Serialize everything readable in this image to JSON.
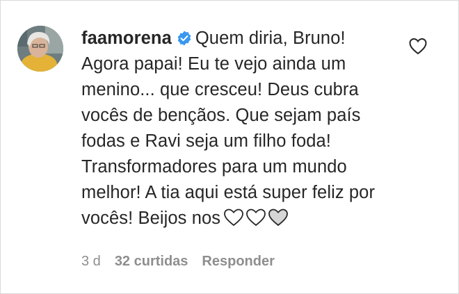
{
  "comment": {
    "username": "faamorena",
    "text": "Quem diria, Bruno! Agora papai! Eu te vejo ainda um menino... que cresceu! Deus cubra vocês de bençãos. Que sejam país fodas e Ravi seja um filho foda! Transformadores para um mundo melhor! A tia aqui está super feliz por vocês! Beijos nos",
    "emojis": [
      "white-heart",
      "white-heart",
      "grey-heart"
    ],
    "time": "3 d",
    "likes": "32 curtidas",
    "reply_label": "Responder"
  },
  "icons": {
    "verified": "verified-badge-icon",
    "like": "heart-outline-icon"
  },
  "colors": {
    "verified": "#3897f0",
    "meta": "#8e8e8e",
    "text": "#262626"
  }
}
